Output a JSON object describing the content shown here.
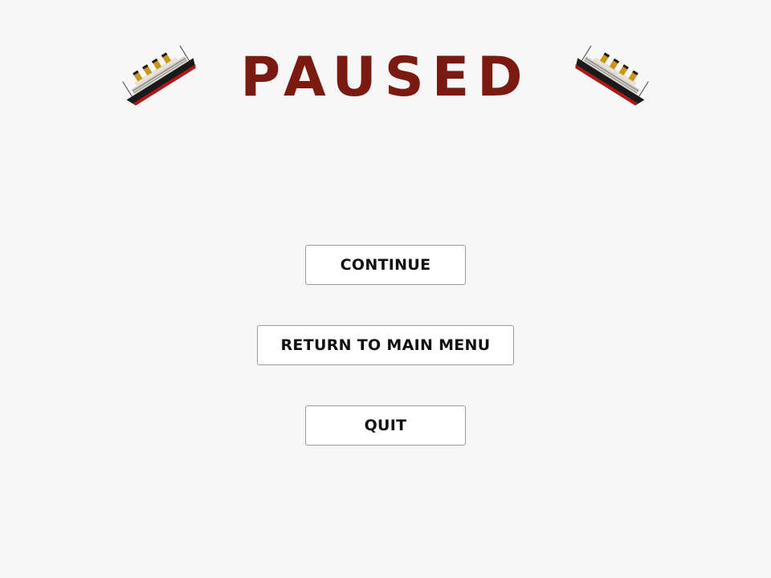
{
  "screen": {
    "title": "PAUSED"
  },
  "decorations": {
    "left_icon": "sinking-ship-icon",
    "right_icon": "sinking-ship-icon"
  },
  "menu": {
    "continue_label": "CONTINUE",
    "main_menu_label": "RETURN TO MAIN MENU",
    "quit_label": "QUIT"
  },
  "colors": {
    "background": "#f7f7f7",
    "title": "#7a1a10",
    "button_background": "#ffffff",
    "button_border": "#9a9a9a",
    "button_text": "#111111",
    "ship_hull": "#1a1a1a",
    "ship_stripe": "#b01818",
    "ship_deck": "#d9d4cc",
    "ship_funnel": "#c9961a"
  }
}
